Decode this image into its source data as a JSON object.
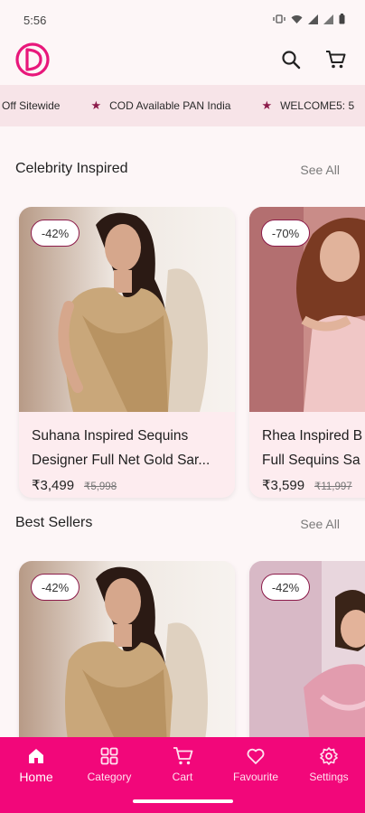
{
  "status_bar": {
    "time": "5:56"
  },
  "header": {
    "logo_icon": "brand-logo-icon",
    "search_icon": "search-icon",
    "cart_icon": "cart-icon",
    "brand_color": "#e8177b"
  },
  "marquee": {
    "items": [
      "Off Sitewide",
      "COD Available PAN India",
      "WELCOME5: 5"
    ]
  },
  "sections": [
    {
      "title": "Celebrity Inspired",
      "see_all": "See All",
      "cards": [
        {
          "discount": "-42%",
          "name_line1": "Suhana Inspired Sequins",
          "name_line2": "Designer Full Net Gold Sar...",
          "price": "₹3,499",
          "mrp": "₹5,998"
        },
        {
          "discount": "-70%",
          "name_line1": "Rhea Inspired B",
          "name_line2": "Full Sequins Sa",
          "price": "₹3,599",
          "mrp": "₹11,997"
        }
      ]
    },
    {
      "title": "Best Sellers",
      "see_all": "See All",
      "cards": [
        {
          "discount": "-42%"
        },
        {
          "discount": "-42%"
        }
      ]
    }
  ],
  "bottom_nav": {
    "items": [
      {
        "label": "Home",
        "icon": "home-icon",
        "active": true
      },
      {
        "label": "Category",
        "icon": "category-icon",
        "active": false
      },
      {
        "label": "Cart",
        "icon": "cart-icon",
        "active": false
      },
      {
        "label": "Favourite",
        "icon": "heart-icon",
        "active": false
      },
      {
        "label": "Settings",
        "icon": "gear-icon",
        "active": false
      }
    ]
  }
}
